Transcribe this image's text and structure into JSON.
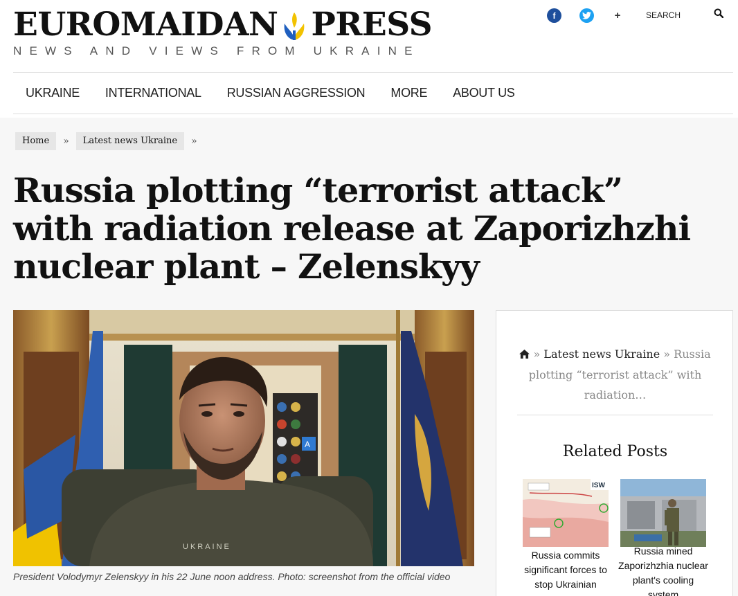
{
  "brand": {
    "name_left": "EUROMAIDAN",
    "name_right": "PRESS",
    "tagline": "NEWS AND VIEWS FROM UKRAINE",
    "dove_colors": {
      "blue": "#1f5fbf",
      "yellow": "#f2c200"
    }
  },
  "social": {
    "facebook_glyph": "f",
    "plus_glyph": "+",
    "search_label": "SEARCH"
  },
  "nav": {
    "items": [
      "UKRAINE",
      "INTERNATIONAL",
      "RUSSIAN AGGRESSION",
      "MORE",
      "ABOUT US"
    ]
  },
  "breadcrumb": {
    "home": "Home",
    "section": "Latest news Ukraine",
    "separator": "»"
  },
  "article": {
    "title": "Russia plotting “terrorist attack” with radiation release at Zaporizhzhi nuclear plant – Zelenskyy",
    "photo_shirt_text": "UKRAINE",
    "caption": "President Volodymyr Zelenskyy in his 22 June noon address. Photo: screenshot from the official video"
  },
  "sidebar": {
    "crumb_sep": "»",
    "crumb_section": "Latest news Ukraine",
    "crumb_current": "Russia plotting “terrorist attack” with radiation…",
    "related_title": "Related Posts",
    "related": [
      {
        "title": "Russia commits significant forces to stop Ukrainian",
        "thumb_label": "ISW"
      },
      {
        "title": "Russia mined Zaporizhzhia nuclear plant's cooling system"
      }
    ]
  },
  "colors": {
    "facebook": "#1e4f9c",
    "twitter": "#1da1f2",
    "background": "#f7f7f7"
  }
}
